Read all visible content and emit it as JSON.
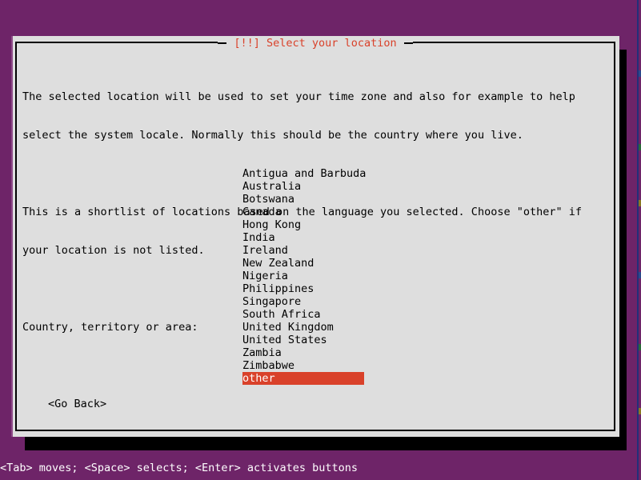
{
  "screen": {
    "background_color": "#6e2468",
    "text_color": "#000000",
    "dialog_bg": "#dedede",
    "accent_color": "#d9412a",
    "status_text_color": "#ffffff"
  },
  "dialog": {
    "title": "[!!] Select your location",
    "paragraphs": [
      "The selected location will be used to set your time zone and also for example to help",
      "select the system locale. Normally this should be the country where you live.",
      "",
      "This is a shortlist of locations based on the language you selected. Choose \"other\" if",
      "your location is not listed.",
      "",
      "Country, territory or area:"
    ],
    "list": {
      "label": "Country, territory or area:",
      "items": [
        {
          "label": "Antigua and Barbuda",
          "selected": false
        },
        {
          "label": "Australia",
          "selected": false
        },
        {
          "label": "Botswana",
          "selected": false
        },
        {
          "label": "Canada",
          "selected": false
        },
        {
          "label": "Hong Kong",
          "selected": false
        },
        {
          "label": "India",
          "selected": false
        },
        {
          "label": "Ireland",
          "selected": false
        },
        {
          "label": "New Zealand",
          "selected": false
        },
        {
          "label": "Nigeria",
          "selected": false
        },
        {
          "label": "Philippines",
          "selected": false
        },
        {
          "label": "Singapore",
          "selected": false
        },
        {
          "label": "South Africa",
          "selected": false
        },
        {
          "label": "United Kingdom",
          "selected": false
        },
        {
          "label": "United States",
          "selected": false
        },
        {
          "label": "Zambia",
          "selected": false
        },
        {
          "label": "Zimbabwe",
          "selected": false
        },
        {
          "label": "other",
          "selected": true
        }
      ]
    },
    "buttons": {
      "go_back": "<Go Back>"
    }
  },
  "statusbar": {
    "hint": "<Tab> moves; <Space> selects; <Enter> activates buttons"
  }
}
